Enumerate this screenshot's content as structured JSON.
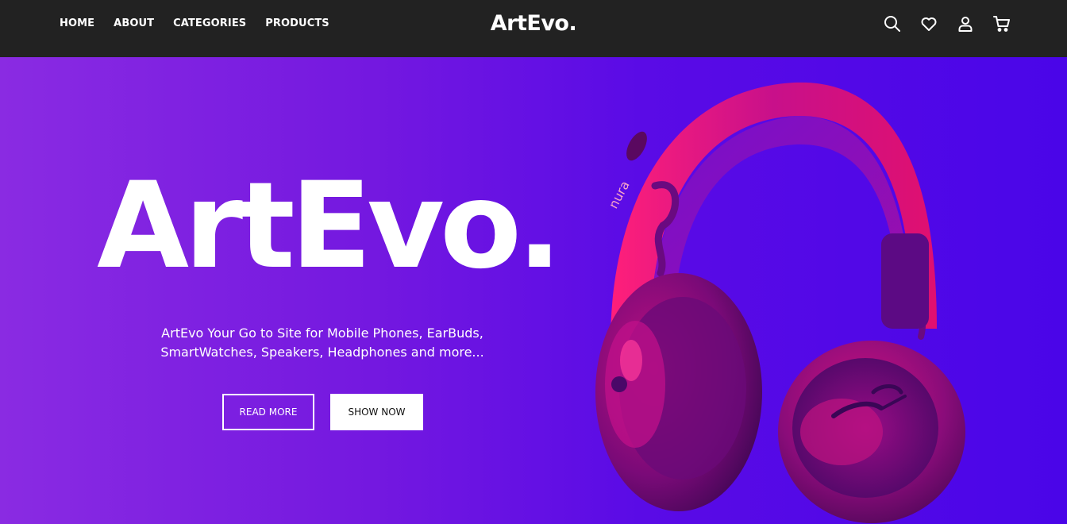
{
  "nav": {
    "links": [
      "HOME",
      "ABOUT",
      "CATEGORIES",
      "PRODUCTS"
    ],
    "brand": "ArtEvo.",
    "icons": [
      "search-icon",
      "heart-icon",
      "user-icon",
      "cart-icon"
    ]
  },
  "hero": {
    "title": "ArtEvo.",
    "tagline_line1": "ArtEvo Your Go to Site for Mobile Phones, EarBuds,",
    "tagline_line2": "SmartWatches, Speakers, Headphones and more...",
    "read_more_label": "READ MORE",
    "show_now_label": "SHOW NOW",
    "product_brand_text": "nura"
  },
  "colors": {
    "navbar_bg": "#222222",
    "hero_gradient_start": "#8a2be2",
    "hero_gradient_end": "#4a05e8",
    "headphone_pink": "#e0106e"
  }
}
